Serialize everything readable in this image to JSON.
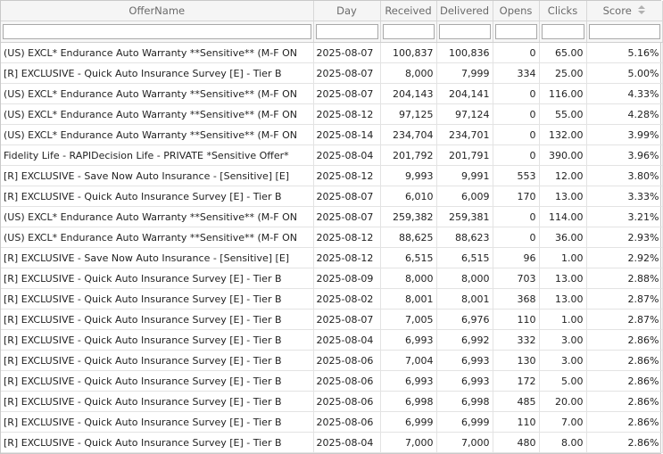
{
  "columns": {
    "offer": "OfferName",
    "day": "Day",
    "received": "Received",
    "delivered": "Delivered",
    "opens": "Opens",
    "clicks": "Clicks",
    "score": "Score"
  },
  "rows": [
    {
      "offer": "(US) EXCL* Endurance  Auto Warranty **Sensitive** (M-F ON",
      "day": "2025-08-07",
      "received": "100,837",
      "delivered": "100,836",
      "opens": "0",
      "clicks": "65.00",
      "score": "5.16%"
    },
    {
      "offer": "[R] EXCLUSIVE - Quick Auto Insurance Survey  [E] - Tier B",
      "day": "2025-08-07",
      "received": "8,000",
      "delivered": "7,999",
      "opens": "334",
      "clicks": "25.00",
      "score": "5.00%"
    },
    {
      "offer": "(US) EXCL* Endurance  Auto Warranty **Sensitive** (M-F ON",
      "day": "2025-08-07",
      "received": "204,143",
      "delivered": "204,141",
      "opens": "0",
      "clicks": "116.00",
      "score": "4.33%"
    },
    {
      "offer": "(US) EXCL* Endurance  Auto Warranty **Sensitive** (M-F ON",
      "day": "2025-08-12",
      "received": "97,125",
      "delivered": "97,124",
      "opens": "0",
      "clicks": "55.00",
      "score": "4.28%"
    },
    {
      "offer": "(US) EXCL* Endurance  Auto Warranty **Sensitive** (M-F ON",
      "day": "2025-08-14",
      "received": "234,704",
      "delivered": "234,701",
      "opens": "0",
      "clicks": "132.00",
      "score": "3.99%"
    },
    {
      "offer": "Fidelity Life - RAPIDecision Life - PRIVATE *Sensitive Offer*",
      "day": "2025-08-04",
      "received": "201,792",
      "delivered": "201,791",
      "opens": "0",
      "clicks": "390.00",
      "score": "3.96%"
    },
    {
      "offer": "[R] EXCLUSIVE - Save Now Auto Insurance - [Sensitive] [E]",
      "day": "2025-08-12",
      "received": "9,993",
      "delivered": "9,991",
      "opens": "553",
      "clicks": "12.00",
      "score": "3.80%"
    },
    {
      "offer": "[R] EXCLUSIVE - Quick Auto Insurance Survey  [E] - Tier B",
      "day": "2025-08-07",
      "received": "6,010",
      "delivered": "6,009",
      "opens": "170",
      "clicks": "13.00",
      "score": "3.33%"
    },
    {
      "offer": "(US) EXCL* Endurance  Auto Warranty **Sensitive** (M-F ON",
      "day": "2025-08-07",
      "received": "259,382",
      "delivered": "259,381",
      "opens": "0",
      "clicks": "114.00",
      "score": "3.21%"
    },
    {
      "offer": "(US) EXCL* Endurance  Auto Warranty **Sensitive** (M-F ON",
      "day": "2025-08-12",
      "received": "88,625",
      "delivered": "88,623",
      "opens": "0",
      "clicks": "36.00",
      "score": "2.93%"
    },
    {
      "offer": "[R] EXCLUSIVE - Save Now Auto Insurance - [Sensitive] [E]",
      "day": "2025-08-12",
      "received": "6,515",
      "delivered": "6,515",
      "opens": "96",
      "clicks": "1.00",
      "score": "2.92%"
    },
    {
      "offer": "[R] EXCLUSIVE - Quick Auto Insurance Survey  [E] - Tier B",
      "day": "2025-08-09",
      "received": "8,000",
      "delivered": "8,000",
      "opens": "703",
      "clicks": "13.00",
      "score": "2.88%"
    },
    {
      "offer": "[R] EXCLUSIVE - Quick Auto Insurance Survey  [E] - Tier B",
      "day": "2025-08-02",
      "received": "8,001",
      "delivered": "8,001",
      "opens": "368",
      "clicks": "13.00",
      "score": "2.87%"
    },
    {
      "offer": "[R] EXCLUSIVE - Quick Auto Insurance Survey  [E] - Tier B",
      "day": "2025-08-07",
      "received": "7,005",
      "delivered": "6,976",
      "opens": "110",
      "clicks": "1.00",
      "score": "2.87%"
    },
    {
      "offer": "[R] EXCLUSIVE - Quick Auto Insurance Survey  [E] - Tier B",
      "day": "2025-08-04",
      "received": "6,993",
      "delivered": "6,992",
      "opens": "332",
      "clicks": "3.00",
      "score": "2.86%"
    },
    {
      "offer": "[R] EXCLUSIVE - Quick Auto Insurance Survey  [E] - Tier B",
      "day": "2025-08-06",
      "received": "7,004",
      "delivered": "6,993",
      "opens": "130",
      "clicks": "3.00",
      "score": "2.86%"
    },
    {
      "offer": "[R] EXCLUSIVE - Quick Auto Insurance Survey  [E] - Tier B",
      "day": "2025-08-06",
      "received": "6,993",
      "delivered": "6,993",
      "opens": "172",
      "clicks": "5.00",
      "score": "2.86%"
    },
    {
      "offer": "[R] EXCLUSIVE - Quick Auto Insurance Survey  [E] - Tier B",
      "day": "2025-08-06",
      "received": "6,998",
      "delivered": "6,998",
      "opens": "485",
      "clicks": "20.00",
      "score": "2.86%"
    },
    {
      "offer": "[R] EXCLUSIVE - Quick Auto Insurance Survey  [E] - Tier B",
      "day": "2025-08-06",
      "received": "6,999",
      "delivered": "6,999",
      "opens": "110",
      "clicks": "7.00",
      "score": "2.86%"
    },
    {
      "offer": "[R] EXCLUSIVE - Quick Auto Insurance Survey  [E] - Tier B",
      "day": "2025-08-04",
      "received": "7,000",
      "delivered": "7,000",
      "opens": "480",
      "clicks": "8.00",
      "score": "2.86%"
    }
  ],
  "filters": {
    "offer": "",
    "day": "",
    "received": "",
    "delivered": "",
    "opens": "",
    "clicks": "",
    "score": ""
  },
  "colors": {
    "header_bg": "#f5f5f5",
    "header_text": "#6a6a6a",
    "grid_line": "#e3e3e3"
  },
  "icons": {
    "score_sort": "sort-arrows-icon"
  }
}
